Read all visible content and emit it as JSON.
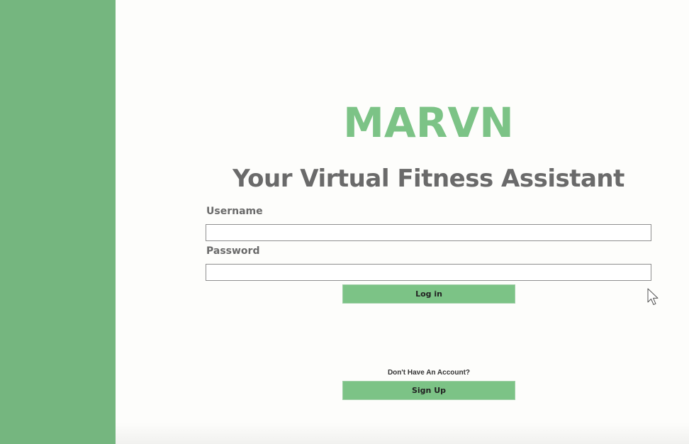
{
  "branding": {
    "app_name": "MARVN",
    "tagline": "Your Virtual Fitness Assistant"
  },
  "login_form": {
    "username_label": "Username",
    "username_value": "",
    "password_label": "Password",
    "password_value": "",
    "login_button_label": "Log in"
  },
  "signup": {
    "prompt": "Don't Have An Account?",
    "button_label": "Sign Up"
  },
  "colors": {
    "sidebar": "#75b67f",
    "brand_green": "#7cc386",
    "text_gray": "#6a6a6a",
    "background": "#fdfdfb"
  },
  "icons": {
    "cursor": "mouse-pointer-icon"
  }
}
